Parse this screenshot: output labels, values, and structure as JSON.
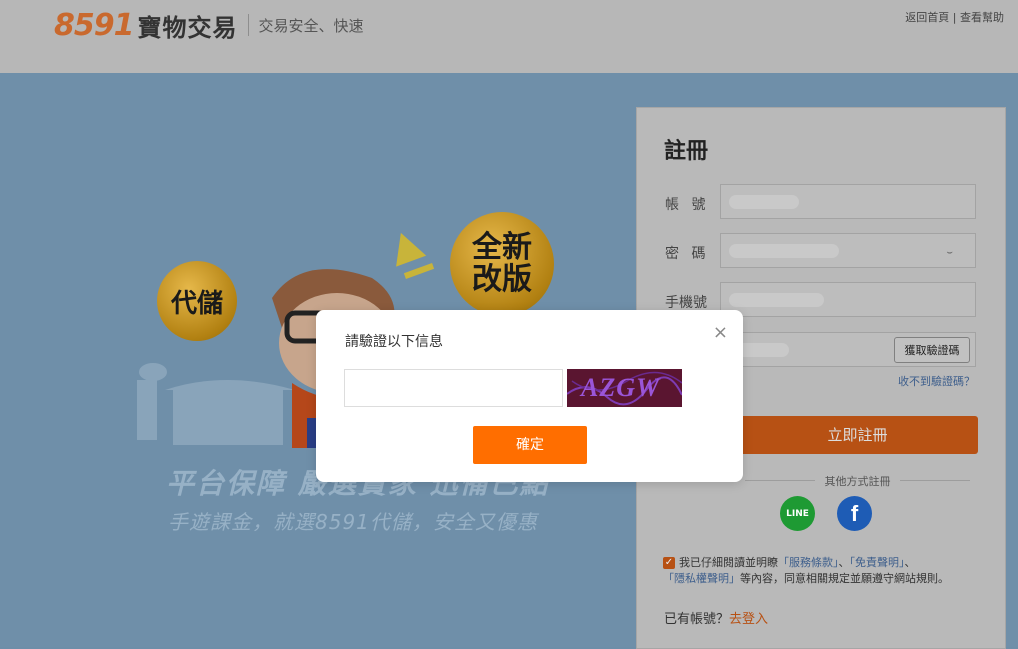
{
  "header": {
    "logo_number": "8591",
    "logo_name": "寶物交易",
    "slogan": "交易安全、快速",
    "links": {
      "home": "返回首頁",
      "separator": "|",
      "help": "查看幫助"
    }
  },
  "banner": {
    "badge_small": "代儲",
    "badge_large": "全新改版",
    "headline": "平台保障  嚴選賣家  迅備已點",
    "subline": "手遊課金，就選8591代儲，安全又優惠"
  },
  "register": {
    "title": "註冊",
    "account_label": "帳 號",
    "password_label": "密 碼",
    "phone_label": "手機號",
    "get_code_button": "獲取驗證碼",
    "no_code_link": "收不到驗證碼？",
    "submit_button": "立即註冊",
    "other_methods": "其他方式註冊",
    "line_icon_text": "LINE",
    "fb_icon_text": "f",
    "agree_prefix": "我已仔細閱讀並明瞭",
    "terms_link": "「服務條款」",
    "sep1": "、",
    "disclaimer_link": "「免責聲明」",
    "sep2": "、",
    "privacy_link": "「隱私權聲明」",
    "agree_suffix": "等內容，同意相關規定並願遵守網站規則。",
    "have_account": "已有帳號？",
    "login_link": "去登入"
  },
  "modal": {
    "title": "請驗證以下信息",
    "captcha_text": "AZGW",
    "input_value": "",
    "confirm_button": "確定",
    "close_symbol": "×"
  }
}
